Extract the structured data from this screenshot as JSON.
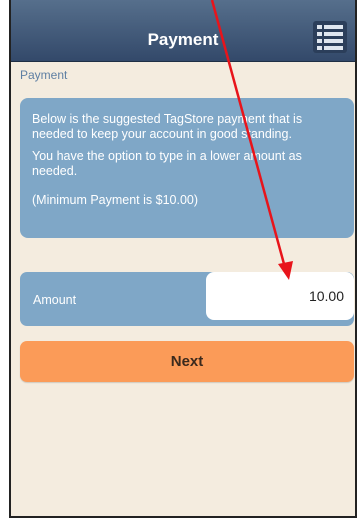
{
  "header": {
    "title": "Payment",
    "menu_icon": "list-menu-icon"
  },
  "payment_section": {
    "label": "Payment",
    "info_lines": [
      "Below is the suggested TagStore payment that is needed to keep your account in good standing.",
      "You have the option to type in a lower amount as needed.",
      "(Minimum Payment is $10.00)"
    ]
  },
  "amount": {
    "label": "Amount",
    "value": "10.00"
  },
  "next_button": {
    "label": "Next"
  },
  "colors": {
    "header": "#33496a",
    "info_box": "#7fa7c7",
    "button": "#fb9b58",
    "background": "#f4ecdf",
    "annotation_arrow": "#e8141b"
  }
}
